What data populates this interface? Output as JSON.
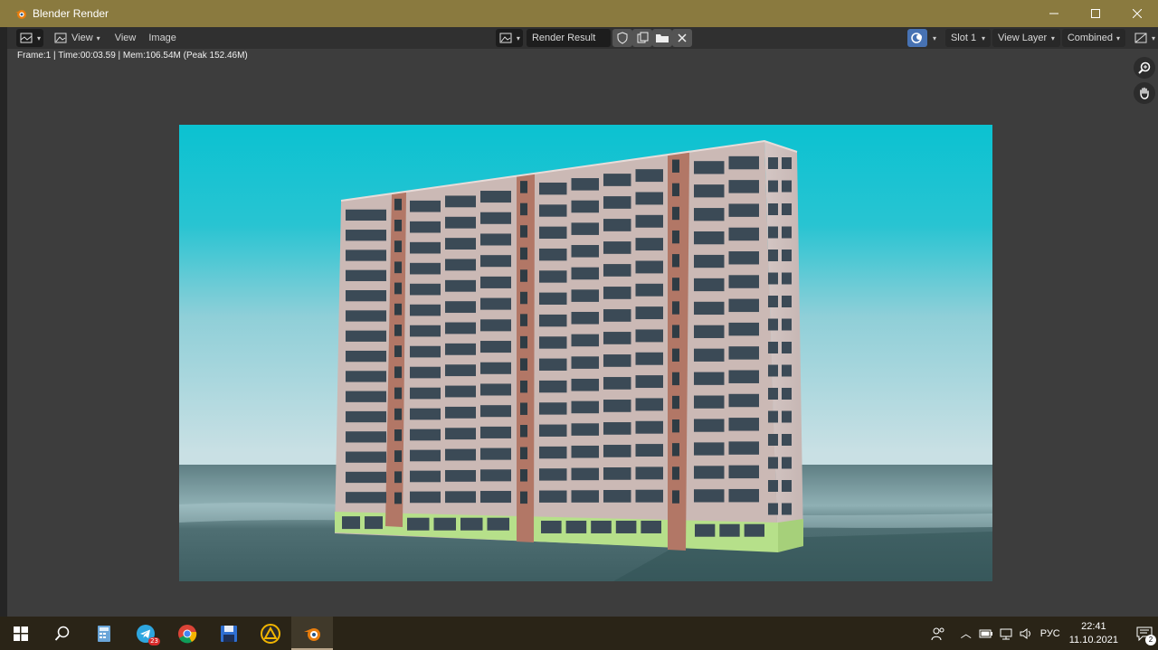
{
  "window": {
    "title": "Blender Render"
  },
  "header": {
    "menu": {
      "view": "View",
      "view2": "View",
      "image": "Image"
    },
    "image_name": "Render Result",
    "slot": "Slot 1",
    "view_layer": "View Layer",
    "pass": "Combined"
  },
  "stats": "Frame:1 | Time:00:03.59 | Mem:106.54M (Peak 152.46M)",
  "taskbar": {
    "telegram_badge": "23",
    "language": "РУС",
    "time": "22:41",
    "date": "11.10.2021",
    "notification_count": "2"
  },
  "colors": {
    "titlebar": "#8a7a3f",
    "sky_top": "#0fc0d0",
    "facade": "#cbb9b5",
    "brick_stripe": "#b27766",
    "ground_floor": "#b6e08a",
    "window_glass": "#3b4a56"
  }
}
